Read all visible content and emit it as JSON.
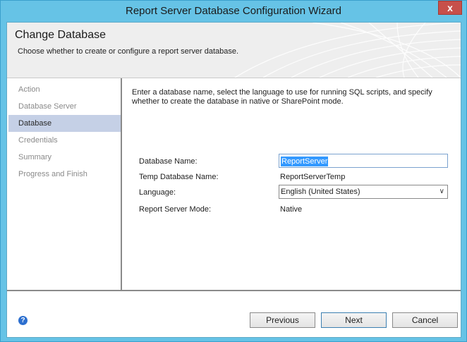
{
  "window": {
    "title": "Report Server Database Configuration Wizard",
    "close_label": "x"
  },
  "header": {
    "title": "Change Database",
    "subtitle": "Choose whether to create or configure a report server database."
  },
  "sidebar": {
    "items": [
      {
        "label": "Action",
        "active": false
      },
      {
        "label": "Database Server",
        "active": false
      },
      {
        "label": "Database",
        "active": true
      },
      {
        "label": "Credentials",
        "active": false
      },
      {
        "label": "Summary",
        "active": false
      },
      {
        "label": "Progress and Finish",
        "active": false
      }
    ]
  },
  "main": {
    "intro": "Enter a database name, select the language to use for running SQL scripts, and specify whether to create the database in native or SharePoint mode.",
    "database_name_label": "Database Name:",
    "database_name_value": "ReportServer",
    "temp_db_label": "Temp Database Name:",
    "temp_db_value": "ReportServerTemp",
    "language_label": "Language:",
    "language_value": "English (United States)",
    "mode_label": "Report Server Mode:",
    "mode_value": "Native"
  },
  "footer": {
    "help_glyph": "?",
    "previous_label": "Previous",
    "next_label": "Next",
    "cancel_label": "Cancel"
  },
  "colors": {
    "titlebar": "#66c3e6",
    "close_button": "#c7504a",
    "active_nav": "#c5d0e6",
    "selection": "#3399ff"
  }
}
